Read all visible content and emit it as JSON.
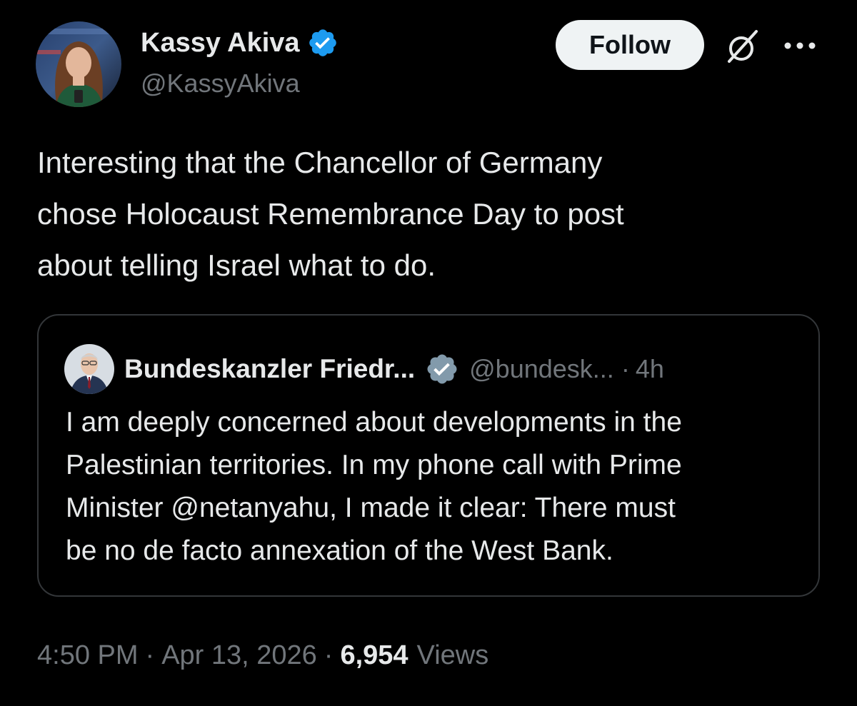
{
  "author": {
    "name": "Kassy Akiva",
    "handle": "@KassyAkiva",
    "verified": true
  },
  "actions": {
    "follow_label": "Follow",
    "grok_icon": "grok-icon",
    "more_icon": "more-icon"
  },
  "tweet": {
    "text_lines": [
      "Interesting that the Chancellor of Germany",
      "chose Holocaust Remembrance Day to post",
      "about telling Israel what to do."
    ]
  },
  "quoted_tweet": {
    "name": "Bundeskanzler Friedr...",
    "verified": true,
    "handle": "@bundesk...",
    "separator": "·",
    "time": "4h",
    "text_lines": [
      "I am deeply concerned about developments in the",
      "Palestinian territories. In my phone call with Prime",
      "Minister @netanyahu, I made it clear: There must",
      "be no de facto annexation of the West Bank."
    ]
  },
  "meta": {
    "time": "4:50 PM",
    "separator": "·",
    "date": "Apr 13, 2026",
    "views_count": "6,954",
    "views_label": "Views"
  },
  "colors": {
    "background": "#000000",
    "primary_text": "#e7e9ea",
    "secondary_text": "#71767b",
    "verified_blue": "#1d9bf0",
    "verified_gray": "#829aab",
    "follow_button_bg": "#eff3f4",
    "card_border": "#333639"
  }
}
